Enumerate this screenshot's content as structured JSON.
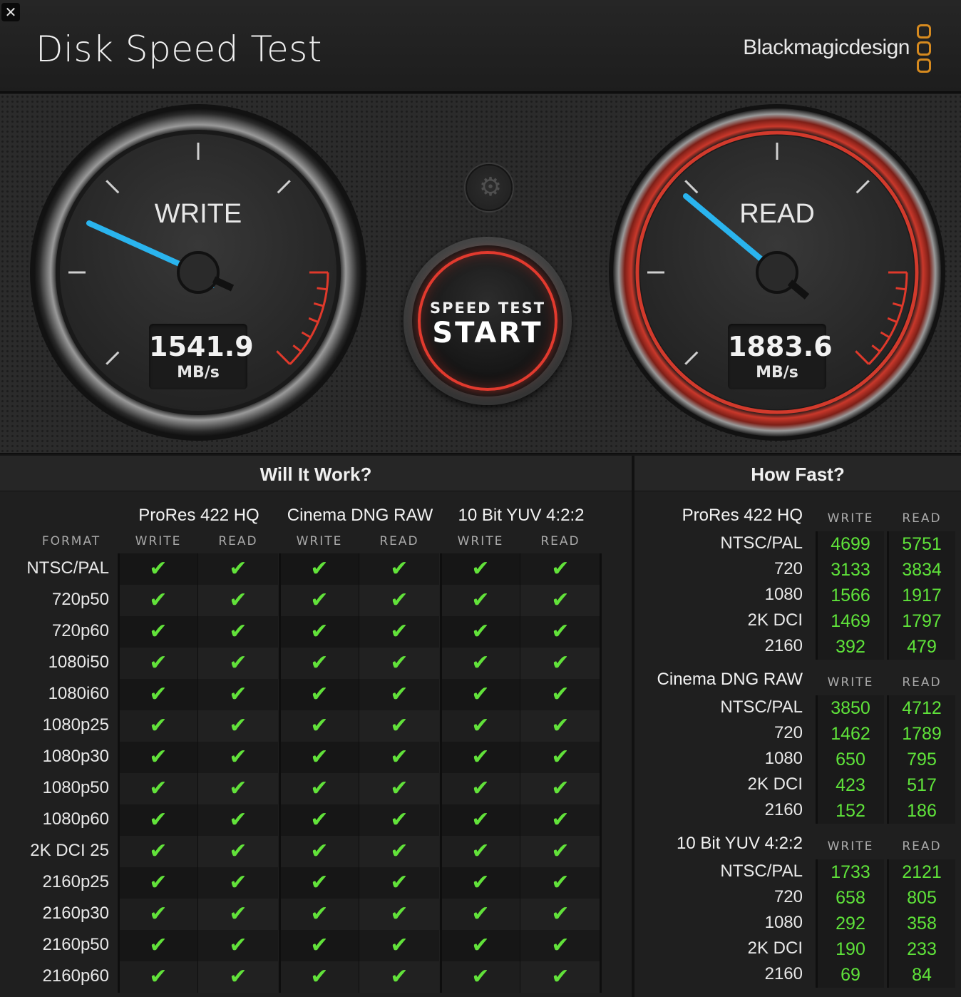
{
  "app": {
    "close_label": "✕",
    "title": "Disk Speed Test",
    "brand": "Blackmagicdesign"
  },
  "gauges": {
    "write": {
      "label": "WRITE",
      "value": "1541.9",
      "unit": "MB/s",
      "accent": "#2ab4ee"
    },
    "read": {
      "label": "READ",
      "value": "1883.6",
      "unit": "MB/s",
      "accent": "#2ab4ee"
    }
  },
  "controls": {
    "settings_icon": "gear-icon",
    "start_line1": "SPEED TEST",
    "start_line2": "START",
    "start_ring_color": "#e23a2e"
  },
  "will_it_work": {
    "title": "Will It Work?",
    "format_header": "FORMAT",
    "groups": [
      "ProRes 422 HQ",
      "Cinema DNG RAW",
      "10 Bit YUV 4:2:2"
    ],
    "subheaders": [
      "WRITE",
      "READ",
      "WRITE",
      "READ",
      "WRITE",
      "READ"
    ],
    "formats": [
      "NTSC/PAL",
      "720p50",
      "720p60",
      "1080i50",
      "1080i60",
      "1080p25",
      "1080p30",
      "1080p50",
      "1080p60",
      "2K DCI 25",
      "2160p25",
      "2160p30",
      "2160p50",
      "2160p60"
    ],
    "check_symbol": "✔",
    "check_color": "#62e23a"
  },
  "how_fast": {
    "title": "How Fast?",
    "sections": [
      {
        "name": "ProRes 422 HQ",
        "write_label": "WRITE",
        "read_label": "READ",
        "rows": [
          {
            "label": "NTSC/PAL",
            "write": "4699",
            "read": "5751"
          },
          {
            "label": "720",
            "write": "3133",
            "read": "3834"
          },
          {
            "label": "1080",
            "write": "1566",
            "read": "1917"
          },
          {
            "label": "2K DCI",
            "write": "1469",
            "read": "1797"
          },
          {
            "label": "2160",
            "write": "392",
            "read": "479"
          }
        ]
      },
      {
        "name": "Cinema DNG RAW",
        "write_label": "WRITE",
        "read_label": "READ",
        "rows": [
          {
            "label": "NTSC/PAL",
            "write": "3850",
            "read": "4712"
          },
          {
            "label": "720",
            "write": "1462",
            "read": "1789"
          },
          {
            "label": "1080",
            "write": "650",
            "read": "795"
          },
          {
            "label": "2K DCI",
            "write": "423",
            "read": "517"
          },
          {
            "label": "2160",
            "write": "152",
            "read": "186"
          }
        ]
      },
      {
        "name": "10 Bit YUV 4:2:2",
        "write_label": "WRITE",
        "read_label": "READ",
        "rows": [
          {
            "label": "NTSC/PAL",
            "write": "1733",
            "read": "2121"
          },
          {
            "label": "720",
            "write": "658",
            "read": "805"
          },
          {
            "label": "1080",
            "write": "292",
            "read": "358"
          },
          {
            "label": "2K DCI",
            "write": "190",
            "read": "233"
          },
          {
            "label": "2160",
            "write": "69",
            "read": "84"
          }
        ]
      }
    ]
  }
}
